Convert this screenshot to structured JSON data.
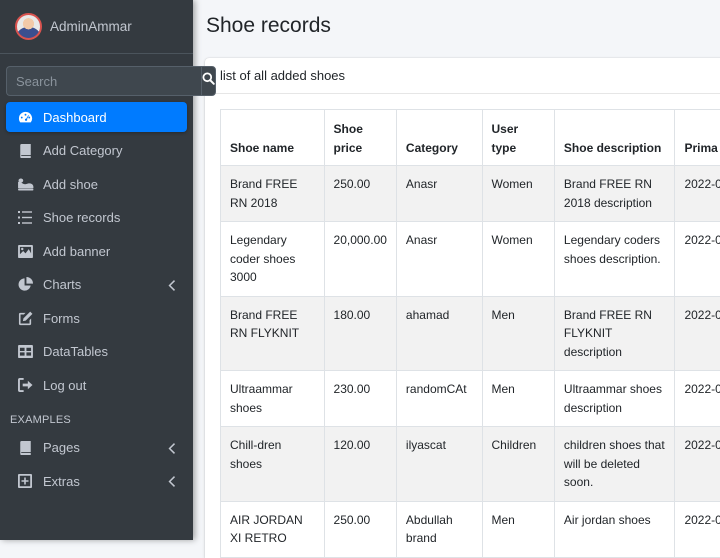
{
  "user": {
    "name": "AdminAmmar"
  },
  "search": {
    "placeholder": "Search"
  },
  "nav": {
    "items": [
      {
        "label": "Dashboard",
        "icon": "tachometer-icon",
        "active": true
      },
      {
        "label": "Add Category",
        "icon": "book-icon"
      },
      {
        "label": "Add shoe",
        "icon": "shoe-icon"
      },
      {
        "label": "Shoe records",
        "icon": "list-icon"
      },
      {
        "label": "Add banner",
        "icon": "image-icon"
      },
      {
        "label": "Charts",
        "icon": "pie-chart-icon",
        "has_submenu": true
      },
      {
        "label": "Forms",
        "icon": "edit-icon"
      },
      {
        "label": "DataTables",
        "icon": "table-icon"
      },
      {
        "label": "Log out",
        "icon": "logout-icon"
      }
    ],
    "header": "EXAMPLES",
    "extra_items": [
      {
        "label": "Pages",
        "icon": "book-icon",
        "has_submenu": true
      },
      {
        "label": "Extras",
        "icon": "plus-square-icon",
        "has_submenu": true
      }
    ]
  },
  "page": {
    "title": "Shoe records"
  },
  "card": {
    "header": "list of all added shoes"
  },
  "table": {
    "columns": [
      "Shoe name",
      "Shoe price",
      "Category",
      "User type",
      "Shoe description",
      "Prima"
    ],
    "rows": [
      [
        "Brand FREE RN 2018",
        "250.00",
        "Anasr",
        "Women",
        "Brand FREE RN 2018 description",
        "2022-0"
      ],
      [
        "Legendary coder shoes 3000",
        "20,000.00",
        "Anasr",
        "Women",
        "Legendary coders shoes description.",
        "2022-0"
      ],
      [
        "Brand FREE RN FLYKNIT",
        "180.00",
        "ahamad",
        "Men",
        "Brand FREE RN FLYKNIT description",
        "2022-0"
      ],
      [
        "Ultraammar shoes",
        "230.00",
        "randomCAt",
        "Men",
        "Ultraammar shoes description",
        "2022-0"
      ],
      [
        "Chill-dren shoes",
        "120.00",
        "ilyascat",
        "Children",
        "children shoes that will be deleted soon.",
        "2022-0"
      ],
      [
        "AIR JORDAN XI RETRO",
        "250.00",
        "Abdullah brand",
        "Men",
        "Air jordan shoes",
        "2022-0"
      ]
    ]
  },
  "colors": {
    "sidebar_bg": "#343a40",
    "active_bg": "#007bff",
    "content_bg": "#f4f6f9"
  }
}
